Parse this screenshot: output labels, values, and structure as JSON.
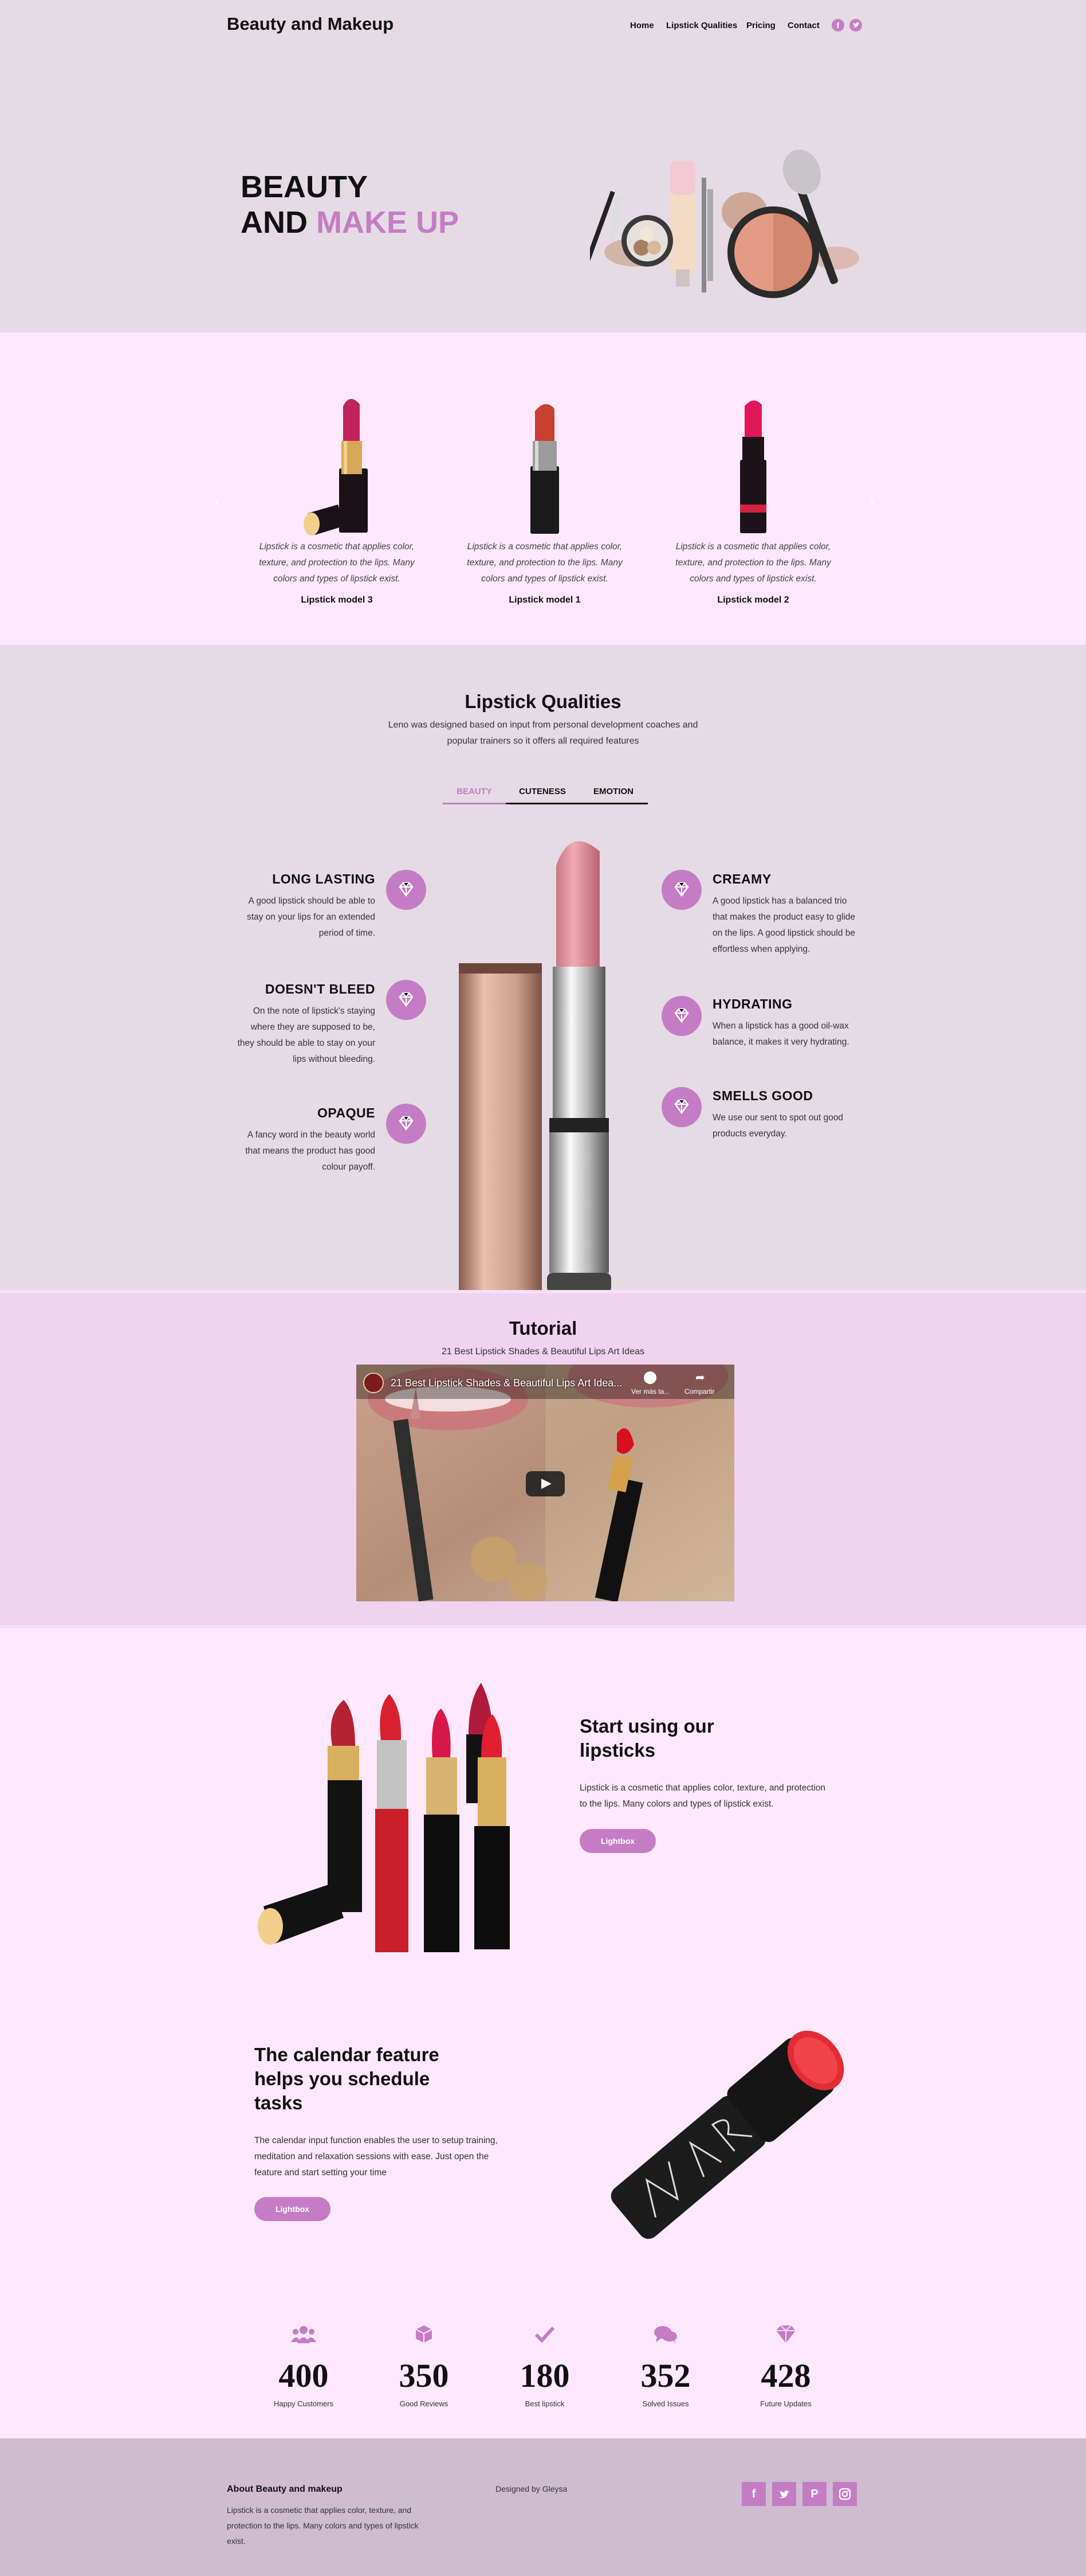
{
  "header": {
    "site_title": "Beauty and Makeup",
    "nav": [
      "Home",
      "Lipstick Qualities",
      "Pricing",
      "Contact"
    ],
    "social_icons": [
      "facebook-icon",
      "twitter-icon"
    ]
  },
  "hero": {
    "line1": "BEAUTY",
    "line2_a": "AND ",
    "line2_b": "MAKE UP"
  },
  "products": [
    {
      "text": "Lipstick is a cosmetic that applies color, texture, and protection to the lips. Many colors and types of lipstick exist.",
      "name": "Lipstick model 3"
    },
    {
      "text": "Lipstick is a cosmetic that applies color, texture, and protection to the lips. Many colors and types of lipstick exist.",
      "name": "Lipstick model 1"
    },
    {
      "text": "Lipstick is a cosmetic that applies color, texture, and protection to the lips. Many colors and types of lipstick exist.",
      "name": "Lipstick model 2"
    }
  ],
  "qualities": {
    "title": "Lipstick Qualities",
    "subtitle_line1": "Leno was designed based on input from personal development coaches and",
    "subtitle_line2": "popular trainers so it offers all required features",
    "tabs": [
      "BEAUTY",
      "CUTENESS",
      "EMOTION"
    ],
    "left": [
      {
        "title": "LONG LASTING",
        "text": [
          "A good lipstick should be able to",
          "stay on your lips for an extended",
          "period of time."
        ]
      },
      {
        "title": "DOESN'T BLEED",
        "text": [
          "On the note of lipstick's staying",
          "where they are supposed to be,",
          "they should be able to stay on your",
          "lips without bleeding."
        ]
      },
      {
        "title": "OPAQUE",
        "text": [
          "A fancy word in the beauty world",
          "that means the product has good",
          "colour payoff."
        ]
      }
    ],
    "right": [
      {
        "title": "CREAMY",
        "text": [
          "A good lipstick has a balanced trio",
          "that makes the product easy to glide",
          "on the lips. A good lipstick should be",
          "effortless when applying."
        ]
      },
      {
        "title": "HYDRATING",
        "text": [
          "When a lipstick has a good oil-wax",
          "balance, it makes it very hydrating."
        ]
      },
      {
        "title": "SMELLS GOOD",
        "text": [
          "We use our sent to spot out good",
          "products everyday."
        ]
      }
    ]
  },
  "tutorial": {
    "title": "Tutorial",
    "subtitle": "21 Best Lipstick Shades & Beautiful Lips Art Ideas",
    "video_title": "21 Best Lipstick Shades & Beautiful Lips Art Idea...",
    "watch_later": "Ver más ta...",
    "share": "Compartir"
  },
  "start": {
    "title_line1": "Start using our",
    "title_line2": "lipsticks",
    "text_line1": "Lipstick is a cosmetic that applies color, texture, and protection",
    "text_line2": "to the lips. Many colors and types of lipstick exist.",
    "button": "Lightbox"
  },
  "calendar": {
    "title_line1": "The calendar feature",
    "title_line2": "helps you schedule",
    "title_line3": "tasks",
    "text_line1": "The calendar input function enables the user to setup training,",
    "text_line2": "meditation and relaxation sessions with ease. Just open the",
    "text_line3": "feature and start setting your time",
    "button": "Lightbox"
  },
  "stats": [
    {
      "icon": "users-icon",
      "value": "400",
      "label": "Happy Customers"
    },
    {
      "icon": "cube-icon",
      "value": "350",
      "label": "Good Reviews"
    },
    {
      "icon": "check-icon",
      "value": "180",
      "label": "Best lipstick"
    },
    {
      "icon": "comments-icon",
      "value": "352",
      "label": "Solved Issues"
    },
    {
      "icon": "diamond-icon",
      "value": "428",
      "label": "Future Updates"
    }
  ],
  "footer": {
    "about_title": "About Beauty and makeup",
    "about_line1": "Lipstick is a cosmetic that applies color, texture, and",
    "about_line2": "protection to the lips. Many colors and types of lipstick",
    "about_line3": "exist.",
    "designed_by": "Designed by Gleysa",
    "social_icons": [
      "facebook-icon",
      "twitter-icon",
      "pinterest-icon",
      "instagram-icon"
    ]
  },
  "colors": {
    "accent": "#c47dc4",
    "section_light": "#fde8fd",
    "section_gray": "#e5dbe4",
    "footer": "#cdbdcf",
    "tutorial_bg": "#efd3ef"
  }
}
